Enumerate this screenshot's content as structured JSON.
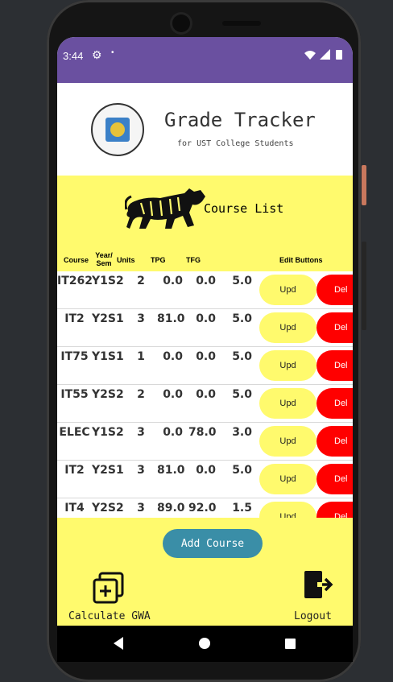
{
  "status": {
    "time": "3:44",
    "settings_icon": "gear-icon",
    "notification_dot": "•",
    "right_icons": "wifi-icon signal-icon battery-icon"
  },
  "header": {
    "title": "Grade Tracker",
    "subtitle": "for UST College Students",
    "logo": "ust-seal-logo"
  },
  "course_list": {
    "title": "Course List",
    "columns": {
      "course": "Course",
      "year": "Year/\nSem",
      "units": "Units",
      "tpg": "TPG",
      "tfg": "TFG",
      "edit": "Edit Buttons"
    },
    "rows": [
      {
        "course": "IT262",
        "year": "Y1S2",
        "units": "2",
        "tpg": "0.0",
        "tfg": "0.0",
        "gwa": "5.0"
      },
      {
        "course": "IT2",
        "year": "Y2S1",
        "units": "3",
        "tpg": "81.0",
        "tfg": "0.0",
        "gwa": "5.0"
      },
      {
        "course": "IT75",
        "year": "Y1S1",
        "units": "1",
        "tpg": "0.0",
        "tfg": "0.0",
        "gwa": "5.0"
      },
      {
        "course": "IT55",
        "year": "Y2S2",
        "units": "2",
        "tpg": "0.0",
        "tfg": "0.0",
        "gwa": "5.0"
      },
      {
        "course": "ELEC",
        "year": "Y1S2",
        "units": "3",
        "tpg": "0.0",
        "tfg": "78.0",
        "gwa": "3.0"
      },
      {
        "course": "IT2",
        "year": "Y2S1",
        "units": "3",
        "tpg": "81.0",
        "tfg": "0.0",
        "gwa": "5.0"
      },
      {
        "course": "IT4",
        "year": "Y2S2",
        "units": "3",
        "tpg": "89.0",
        "tfg": "92.0",
        "gwa": "1.5"
      }
    ],
    "update_label": "Upd",
    "delete_label": "Del"
  },
  "actions": {
    "add_course": "Add Course",
    "calculate": "Calculate GWA",
    "logout": "Logout"
  },
  "colors": {
    "status_bar": "#6a50a0",
    "body_yellow": "#fffa6d",
    "add_button": "#3a8ea7",
    "delete_red": "#ff0000"
  }
}
